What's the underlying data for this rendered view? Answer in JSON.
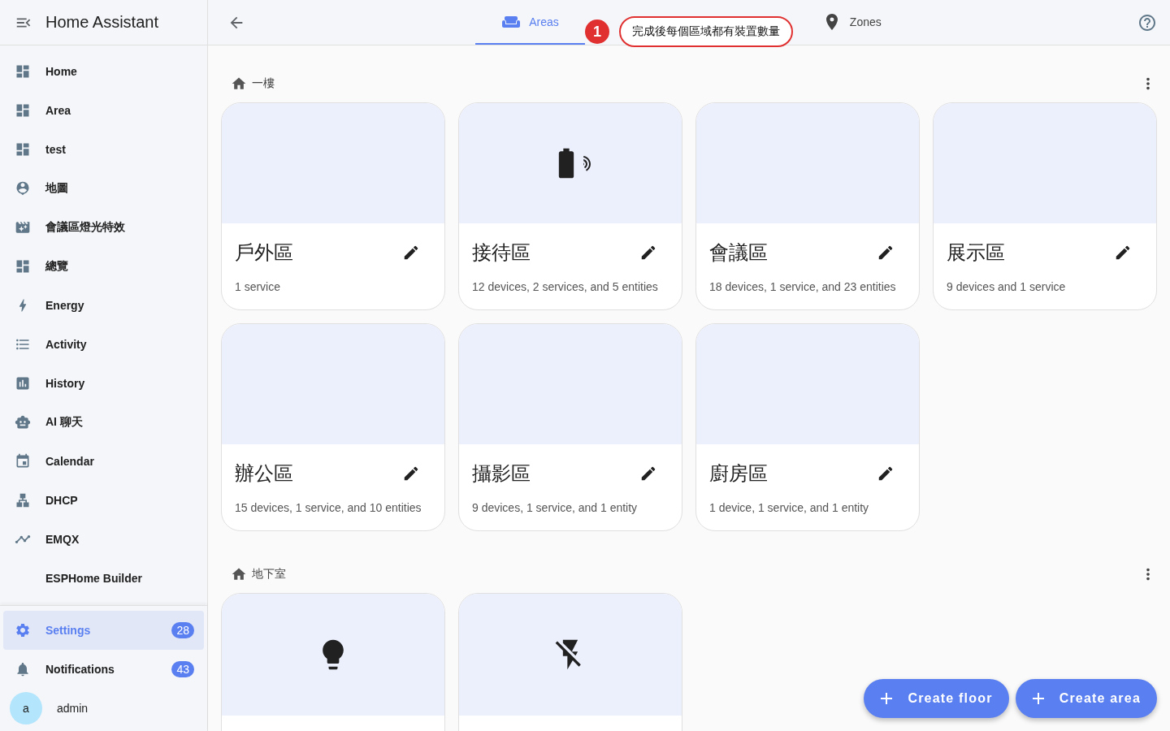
{
  "sidebar": {
    "title": "Home Assistant",
    "items": [
      {
        "label": "Home",
        "selected": false
      },
      {
        "label": "Area",
        "selected": false
      },
      {
        "label": "test",
        "selected": false
      },
      {
        "label": "地圖",
        "selected": false
      },
      {
        "label": "會議區燈光特效",
        "selected": false
      },
      {
        "label": "總覽",
        "selected": false
      },
      {
        "label": "Energy",
        "selected": false
      },
      {
        "label": "Activity",
        "selected": false
      },
      {
        "label": "History",
        "selected": false
      },
      {
        "label": "AI 聊天",
        "selected": false
      },
      {
        "label": "Calendar",
        "selected": false
      },
      {
        "label": "DHCP",
        "selected": false
      },
      {
        "label": "EMQX",
        "selected": false
      },
      {
        "label": "ESPHome Builder",
        "selected": false
      }
    ],
    "bottom_items": [
      {
        "label": "Settings",
        "badge": "28",
        "selected": true
      },
      {
        "label": "Notifications",
        "badge": "43",
        "selected": false
      }
    ],
    "user": {
      "initial": "a",
      "name": "admin"
    }
  },
  "tabs": [
    {
      "label": "Areas",
      "selected": true
    },
    {
      "label": "Zones",
      "selected": false
    }
  ],
  "annotation": {
    "number": "1",
    "text": "完成後每個區域都有裝置數量"
  },
  "floors": [
    {
      "name": "一樓",
      "areas": [
        {
          "name": "戶外區",
          "summary": "1 service",
          "kind": "empty"
        },
        {
          "name": "接待區",
          "summary": "12 devices, 2 services, and 5 entities",
          "kind": "battery"
        },
        {
          "name": "會議區",
          "summary": "18 devices, 1 service, and 23 entities",
          "kind": "empty"
        },
        {
          "name": "展示區",
          "summary": "9 devices and 1 service",
          "kind": "empty"
        },
        {
          "name": "辦公區",
          "summary": "15 devices, 1 service, and 10 entities",
          "kind": "empty"
        },
        {
          "name": "攝影區",
          "summary": "9 devices, 1 service, and 1 entity",
          "kind": "empty"
        },
        {
          "name": "廚房區",
          "summary": "1 device, 1 service, and 1 entity",
          "kind": "empty"
        }
      ]
    },
    {
      "name": "地下室",
      "areas": [
        {
          "kind": "bulb"
        },
        {
          "kind": "flash-off"
        }
      ]
    }
  ],
  "actions": [
    {
      "label": "Create floor"
    },
    {
      "label": "Create area"
    }
  ]
}
